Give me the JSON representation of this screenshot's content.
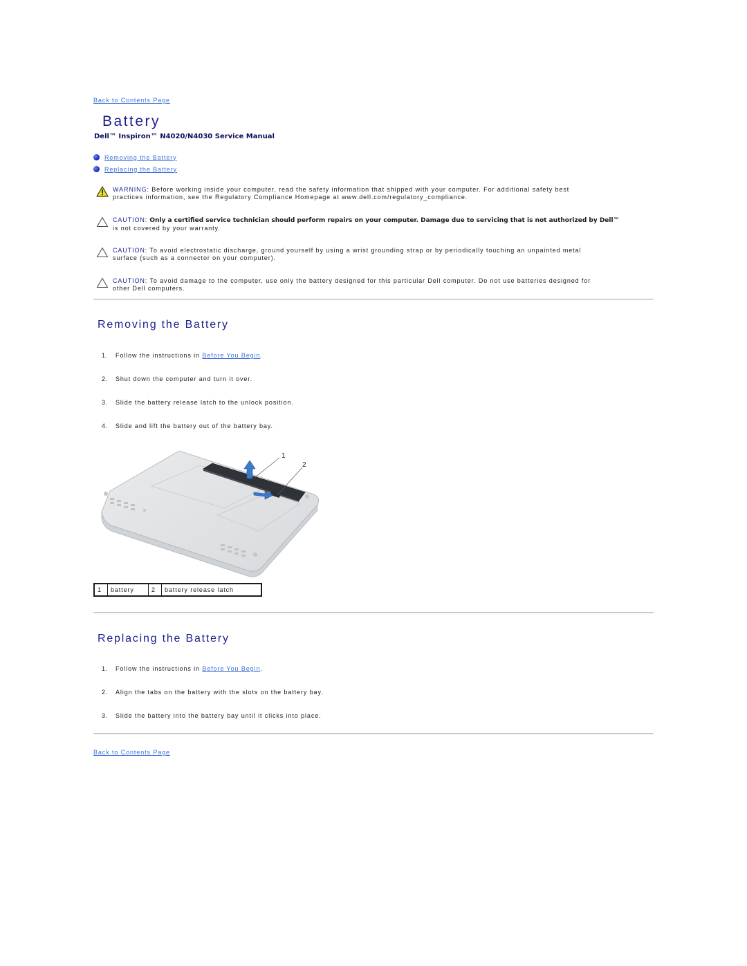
{
  "nav": {
    "back_to_contents_top": "Back to Contents Page",
    "back_to_contents_bottom": "Back to Contents Page"
  },
  "header": {
    "title": "Battery",
    "subtitle": "Dell™ Inspiron™ N4020/N4030 Service Manual"
  },
  "toc": [
    {
      "label": "Removing the Battery",
      "icon": "bullet-icon"
    },
    {
      "label": "Replacing the Battery",
      "icon": "bullet-icon"
    }
  ],
  "notices": [
    {
      "type": "warning",
      "icon": "warning-triangle-icon",
      "label": "WARNING:",
      "bold_text": "",
      "text_line1": " Before working inside your computer, read the safety information that shipped with your computer. For additional safety best",
      "text_line2": "practices information, see the Regulatory Compliance Homepage at www.dell.com/regulatory_compliance."
    },
    {
      "type": "caution",
      "icon": "caution-triangle-icon",
      "label": "CAUTION:",
      "bold_text": " Only a certified service technician should perform repairs on your computer. Damage due to servicing that is not authorized by Dell™",
      "text_line1": "",
      "text_line2": "is not covered by your warranty."
    },
    {
      "type": "caution",
      "icon": "caution-triangle-icon",
      "label": "CAUTION:",
      "bold_text": "",
      "text_line1": " To avoid electrostatic discharge, ground yourself by using a wrist grounding strap or by periodically touching an unpainted metal",
      "text_line2": "surface (such as a connector on your computer)."
    },
    {
      "type": "caution",
      "icon": "caution-triangle-icon",
      "label": "CAUTION:",
      "bold_text": "",
      "text_line1": " To avoid damage to the computer, use only the battery designed for this particular Dell computer. Do not use batteries designed for",
      "text_line2": "other Dell computers."
    }
  ],
  "removing": {
    "heading": "Removing the Battery",
    "steps": [
      {
        "num": "1.",
        "pre": "Follow the instructions in ",
        "link": "Before You Begin",
        "post": "."
      },
      {
        "num": "2.",
        "pre": "Shut down the computer and turn it over.",
        "link": "",
        "post": ""
      },
      {
        "num": "3.",
        "pre": "Slide the battery release latch to the unlock position.",
        "link": "",
        "post": ""
      },
      {
        "num": "4.",
        "pre": "Slide and lift the battery out of the battery bay.",
        "link": "",
        "post": ""
      }
    ],
    "figure": {
      "callouts": [
        "1",
        "2"
      ],
      "description": "laptop-bottom-battery-removal-illustration"
    },
    "legend": [
      {
        "num": "1",
        "label": "battery"
      },
      {
        "num": "2",
        "label": "battery release latch"
      }
    ]
  },
  "replacing": {
    "heading": "Replacing the Battery",
    "steps": [
      {
        "num": "1.",
        "pre": "Follow the instructions in ",
        "link": "Before You Begin",
        "post": "."
      },
      {
        "num": "2.",
        "pre": "Align the tabs on the battery with the slots on the battery bay.",
        "link": "",
        "post": ""
      },
      {
        "num": "3.",
        "pre": "Slide the battery into the battery bay until it clicks into place.",
        "link": "",
        "post": ""
      }
    ]
  },
  "colors": {
    "heading": "#1b1f8c",
    "link": "#3a6fd8",
    "warning_yellow": "#e8e02a",
    "divider": "#bdbdbd"
  }
}
